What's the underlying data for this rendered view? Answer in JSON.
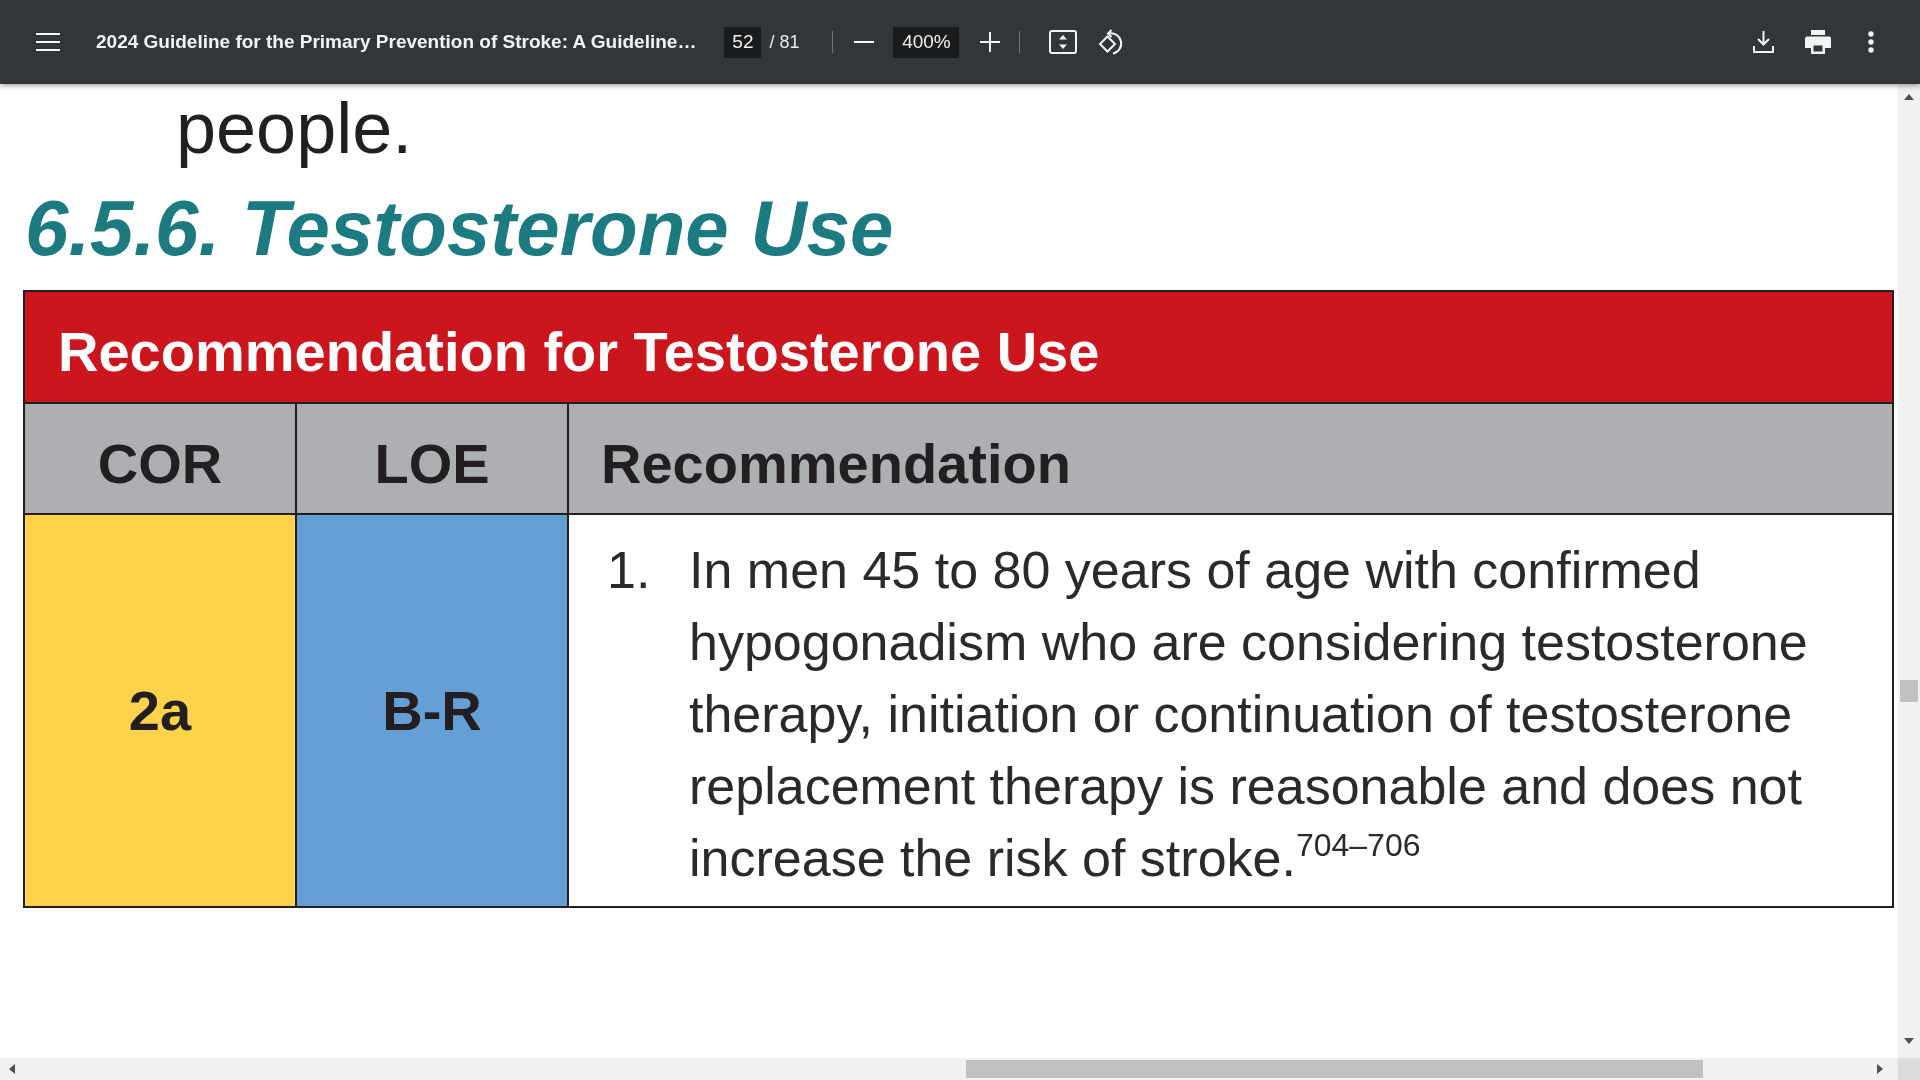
{
  "toolbar": {
    "title": "2024 Guideline for the Primary Prevention of Stroke: A Guideline…",
    "page_number": "52",
    "page_count": "/ 81",
    "zoom": "400%"
  },
  "document": {
    "body_text": "people.",
    "heading": "6.5.6. Testosterone Use",
    "table": {
      "title": "Recommendation for Testosterone Use",
      "columns": [
        "COR",
        "LOE",
        "Recommendation"
      ],
      "rows": [
        {
          "cells": [
            {
              "kind": "class",
              "text": "2a",
              "color": "#fdd34b"
            },
            {
              "kind": "level",
              "text": "B-R",
              "color": "#649fd5"
            },
            {
              "kind": "recommendation",
              "number": "1.",
              "text": "In men 45 to 80 years of age with confirmed hypogonadism who are considering testosterone therapy, initiation or continuation of testosterone replacement therapy is reasonable and does not increase the risk of stroke.$^{704–706}$"
            }
          ]
        }
      ]
    }
  }
}
